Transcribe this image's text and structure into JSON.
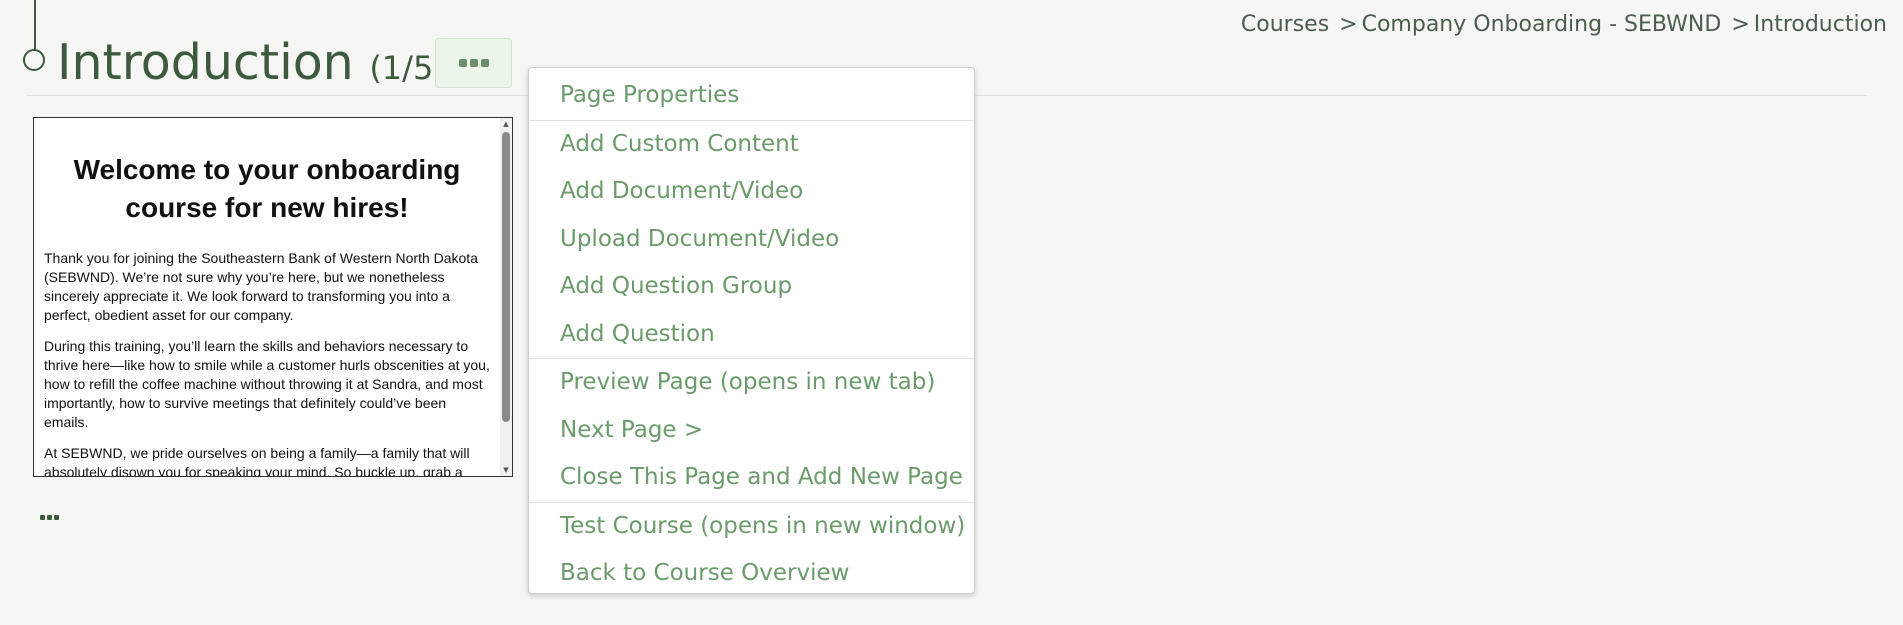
{
  "header": {
    "title": "Introduction",
    "page_count": "(1/5)"
  },
  "breadcrumb": {
    "items": [
      "Courses",
      "Company Onboarding - SEBWND",
      "Introduction"
    ],
    "separator": ">"
  },
  "preview": {
    "heading": "Welcome to your onboarding course for new hires!",
    "paragraphs": [
      "Thank you for joining the Southeastern Bank of Western North Dakota (SEBWND). We’re not sure why you’re here, but we nonetheless sincerely appreciate it. We look forward to transforming you into a perfect, obedient asset for our company.",
      "During this training, you’ll learn the skills and behaviors necessary to thrive here—like how to smile while a customer hurls obscenities at you, how to refill the coffee machine without throwing it at Sandra, and most importantly, how to survive meetings that definitely could’ve been emails.",
      "At SEBWND, we pride ourselves on being a family—a family that will absolutely disown you for speaking your mind. So buckle up, grab a"
    ]
  },
  "menu": {
    "groups": [
      [
        "Page Properties"
      ],
      [
        "Add Custom Content",
        "Add Document/Video",
        "Upload Document/Video",
        "Add Question Group",
        "Add Question"
      ],
      [
        "Preview Page (opens in new tab)",
        "Next Page >",
        "Close This Page and Add New Page"
      ],
      [
        "Test Course (opens in new window)",
        "Back to Course Overview"
      ]
    ]
  },
  "colors": {
    "primary_dark": "#3e5a3e",
    "menu_text": "#6b9a6b",
    "toggle_bg": "#ecf5ea"
  },
  "icons": {
    "menu_toggle": "more-horizontal-icon",
    "small_more": "more-horizontal-icon"
  }
}
